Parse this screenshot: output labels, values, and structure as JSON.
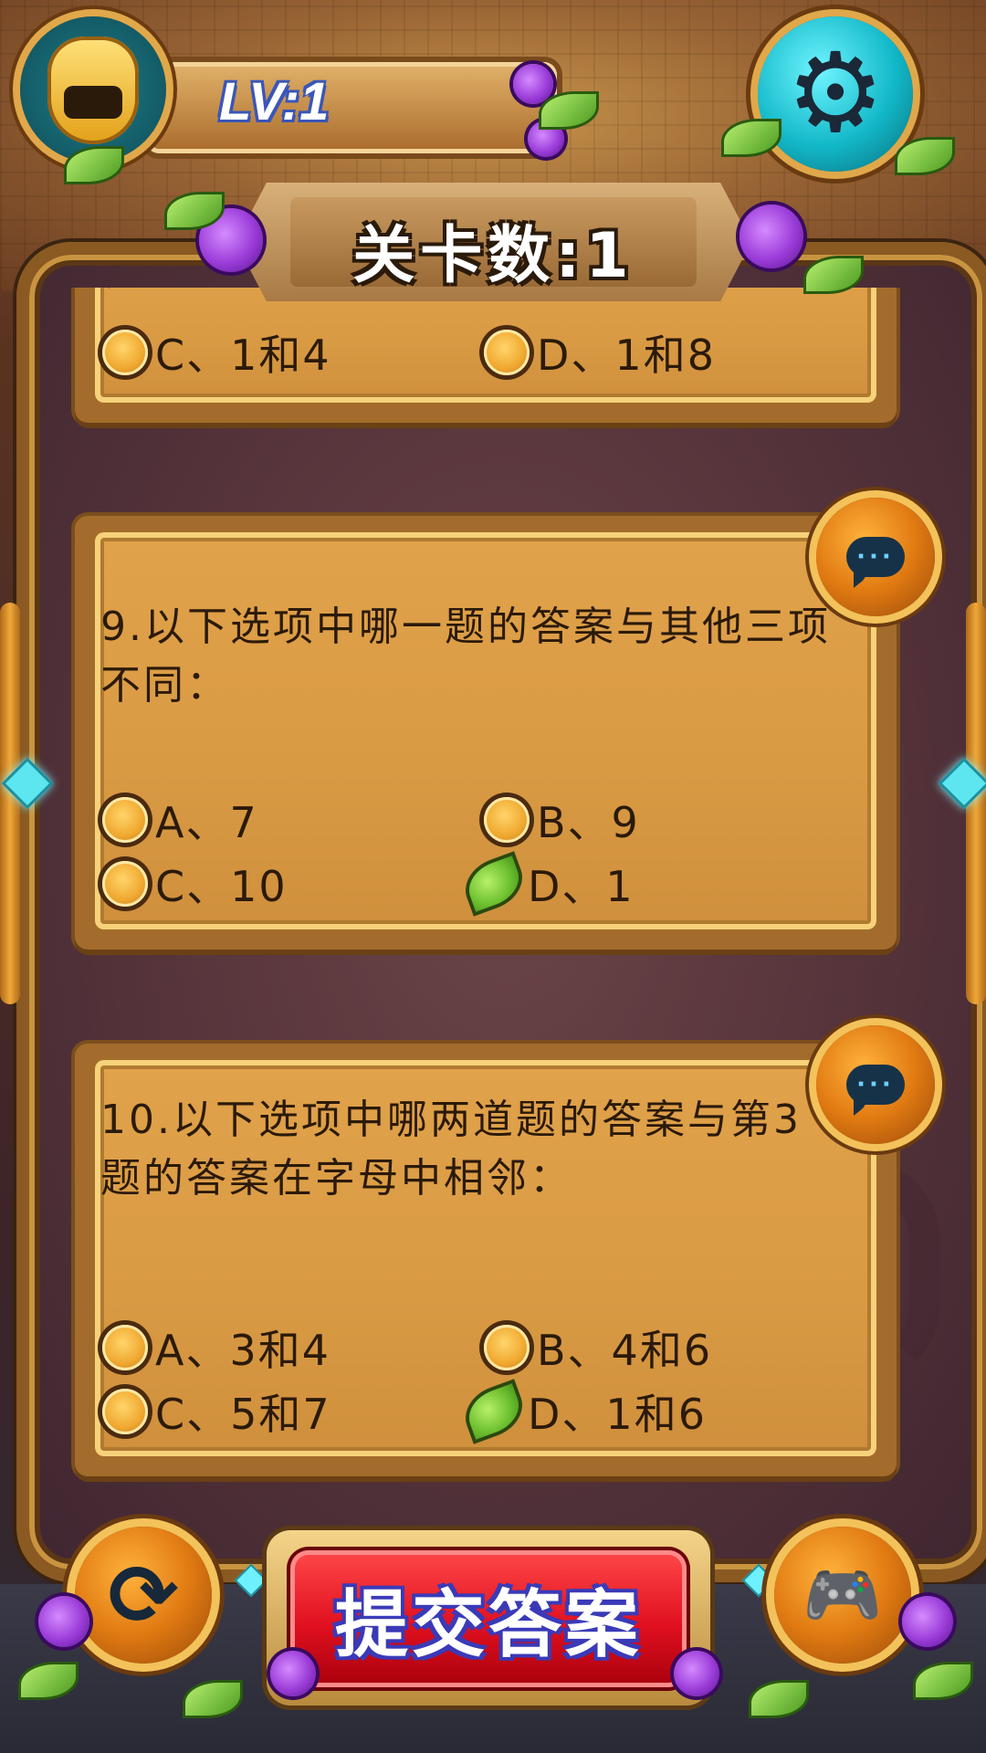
{
  "header": {
    "level_label": "LV:1",
    "stage_label": "关卡数:1"
  },
  "cards": [
    {
      "question": "",
      "options": [
        {
          "label": "C、1和4",
          "selected": false
        },
        {
          "label": "D、1和8",
          "selected": false
        }
      ]
    },
    {
      "question": "9.以下选项中哪一题的答案与其他三项不同：",
      "options": [
        {
          "label": "A、7",
          "selected": false
        },
        {
          "label": "B、9",
          "selected": false
        },
        {
          "label": "C、10",
          "selected": false
        },
        {
          "label": "D、1",
          "selected": true
        }
      ]
    },
    {
      "question": "10.以下选项中哪两道题的答案与第3题的答案在字母中相邻：",
      "options": [
        {
          "label": "A、3和4",
          "selected": false
        },
        {
          "label": "B、4和6",
          "selected": false
        },
        {
          "label": "C、5和7",
          "selected": false
        },
        {
          "label": "D、1和6",
          "selected": true
        }
      ]
    }
  ],
  "footer": {
    "submit_label": "提交答案",
    "refresh_icon": "refresh-icon",
    "gamepad_icon": "gamepad-icon"
  },
  "colors": {
    "accent_orange": "#e07a12",
    "submit_red": "#e01020",
    "settings_cyan": "#12b8c8"
  }
}
